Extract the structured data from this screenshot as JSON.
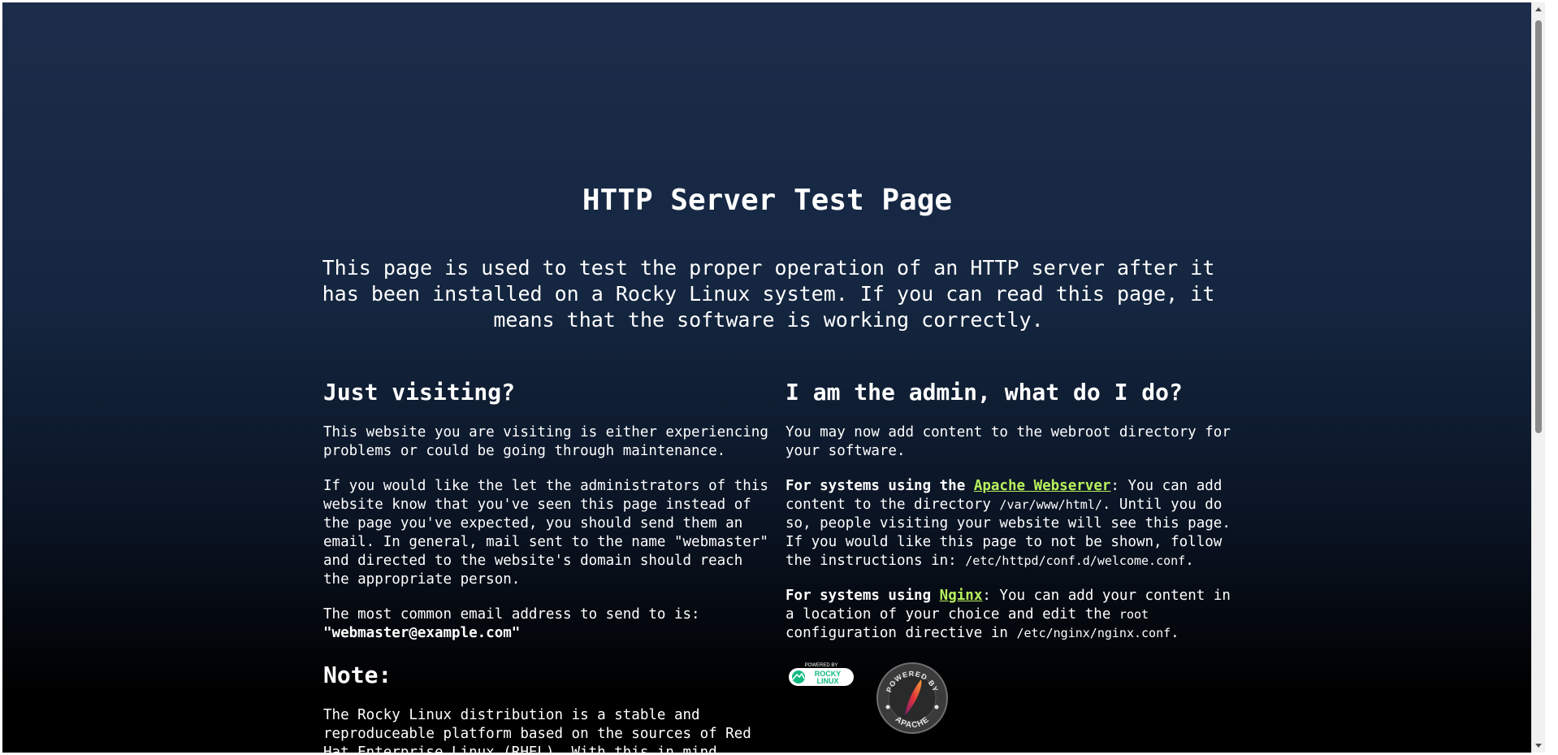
{
  "page": {
    "title": "HTTP Server Test Page",
    "intro": "This page is used to test the proper operation of an HTTP server after it has been installed on a Rocky Linux system. If you can read this page, it means that the software is working correctly."
  },
  "visitor": {
    "heading": "Just visiting?",
    "p1": "This website you are visiting is either experiencing problems or could be going through maintenance.",
    "p2": "If you would like the let the administrators of this website know that you've seen this page instead of the page you've expected, you should send them an email. In general, mail sent to the name \"webmaster\" and directed to the website's domain should reach the appropriate person.",
    "p3": "The most common email address to send to is:",
    "email": "\"webmaster@example.com\""
  },
  "note": {
    "heading": "Note:",
    "p1": "The Rocky Linux distribution is a stable and reproduceable platform based on the sources of Red Hat Enterprise Linux (RHEL). With this in mind,"
  },
  "admin": {
    "heading": "I am the admin, what do I do?",
    "p1": "You may now add content to the webroot directory for your software.",
    "apache_lead": "For systems using the",
    "apache_link": "Apache Webserver",
    "apache_text1": ": You can add content to the directory",
    "apache_path1": "/var/www/html/",
    "apache_text2": ". Until you do so, people visiting your website will see this page. If you would like this page to not be shown, follow the instructions in:",
    "apache_path2": "/etc/httpd/conf.d/welcome.conf",
    "apache_text3": ".",
    "nginx_lead": "For systems using",
    "nginx_link": "Nginx",
    "nginx_text1": ": You can add your content in a location of your choice and edit the",
    "nginx_root": "root",
    "nginx_text2": "configuration directive in",
    "nginx_path": "/etc/nginx/nginx.conf",
    "nginx_text3": "."
  },
  "logos": {
    "rocky_top": "POWERED BY",
    "rocky_line1": "ROCKY",
    "rocky_line2": "LINUX",
    "apache_top": "POWERED BY",
    "apache_bottom": "APACHE"
  },
  "colors": {
    "link": "#b8f15c",
    "rocky_green": "#10b981",
    "background_top": "#1b2d4a",
    "background_bottom": "#000000"
  }
}
